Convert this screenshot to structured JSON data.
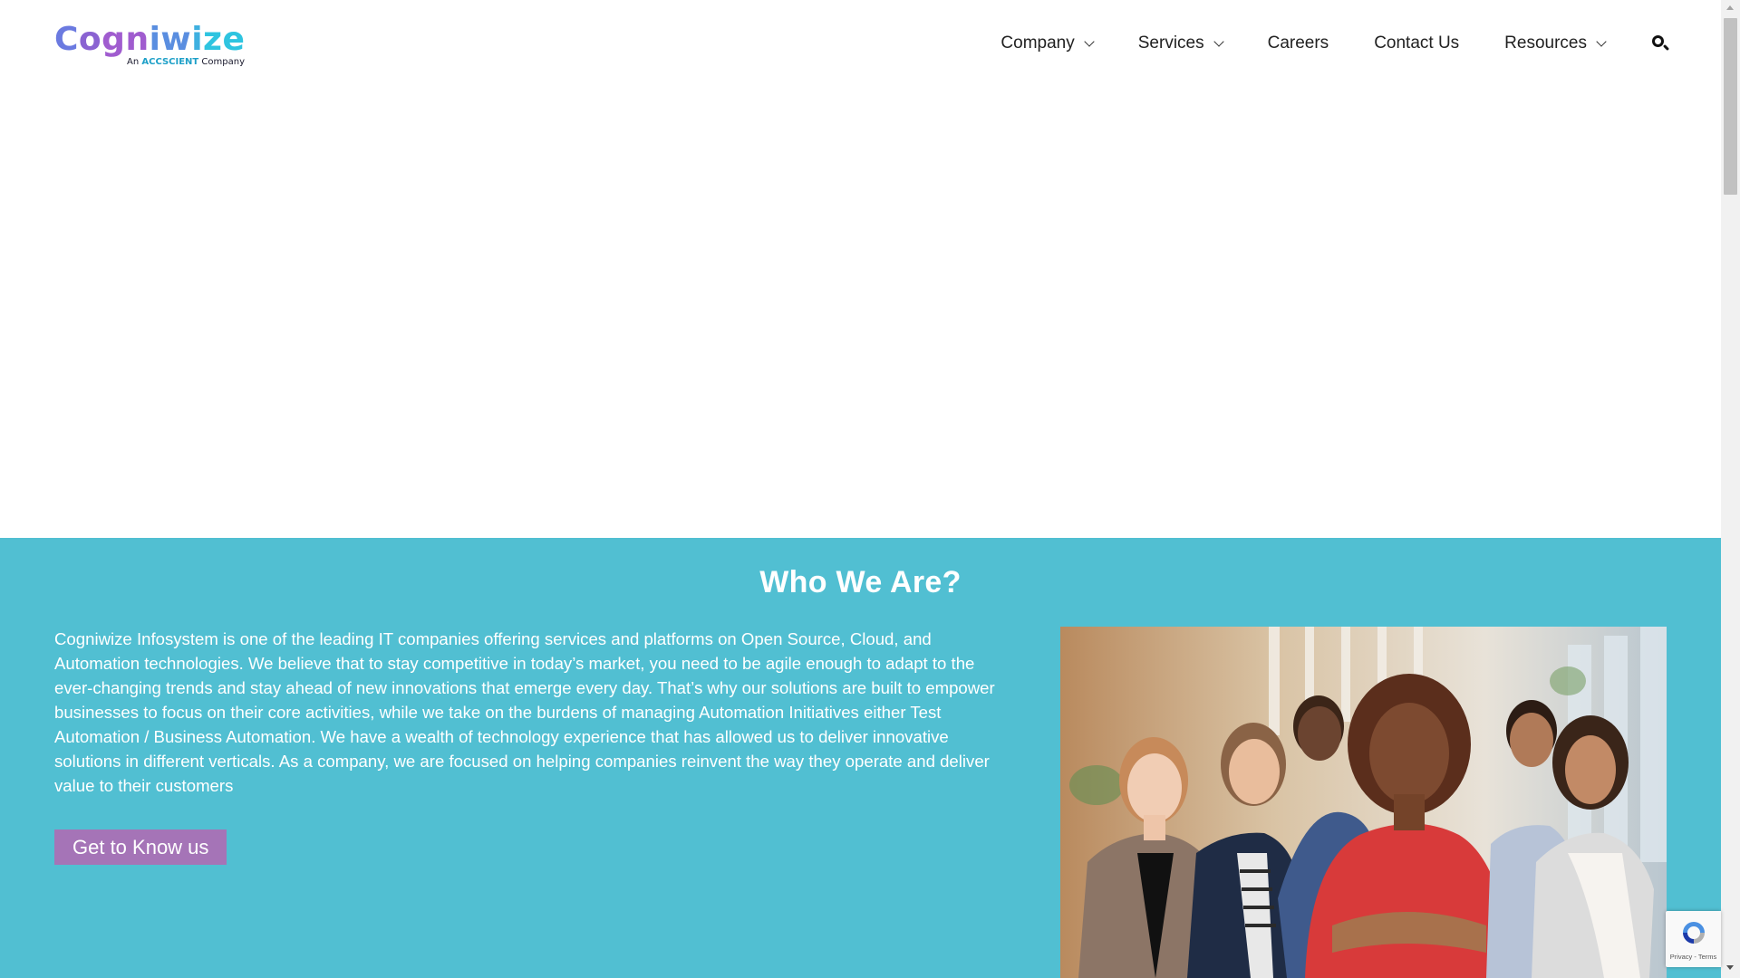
{
  "logo": {
    "word": [
      "C",
      "o",
      "g",
      "n",
      "i",
      "w",
      "i",
      "z",
      "e"
    ],
    "tagline_prefix": "An ",
    "tagline_brand": "ACCSCIENT",
    "tagline_suffix": " Company"
  },
  "nav": {
    "items": [
      {
        "label": "Company",
        "dropdown": true
      },
      {
        "label": "Services",
        "dropdown": true
      },
      {
        "label": "Careers",
        "dropdown": false
      },
      {
        "label": "Contact Us",
        "dropdown": false
      },
      {
        "label": "Resources",
        "dropdown": true
      }
    ],
    "search_icon": "search-icon"
  },
  "about": {
    "title": "Who We Are?",
    "body": "Cogniwize Infosystem is one of the leading IT companies offering services and platforms on Open Source, Cloud, and Automation technologies. We believe that to stay competitive in today’s market, you need to be agile enough to adapt to the ever-changing trends and stay ahead of new innovations that emerge every day. That’s why our solutions are built to empower businesses to focus on their core activities, while we take on the burdens of managing Automation Initiatives either Test Automation / Business Automation. We have a wealth of technology experience that has allowed us to deliver innovative solutions in different verticals. As a company, we are focused on helping companies reinvent the way they operate and deliver value to their customers",
    "button_label": "Get to Know us"
  },
  "recaptcha": {
    "terms": "Privacy - Terms"
  },
  "colors": {
    "about_bg": "#51bfd2",
    "button_bg": "#a574b7",
    "text": "#222222"
  }
}
